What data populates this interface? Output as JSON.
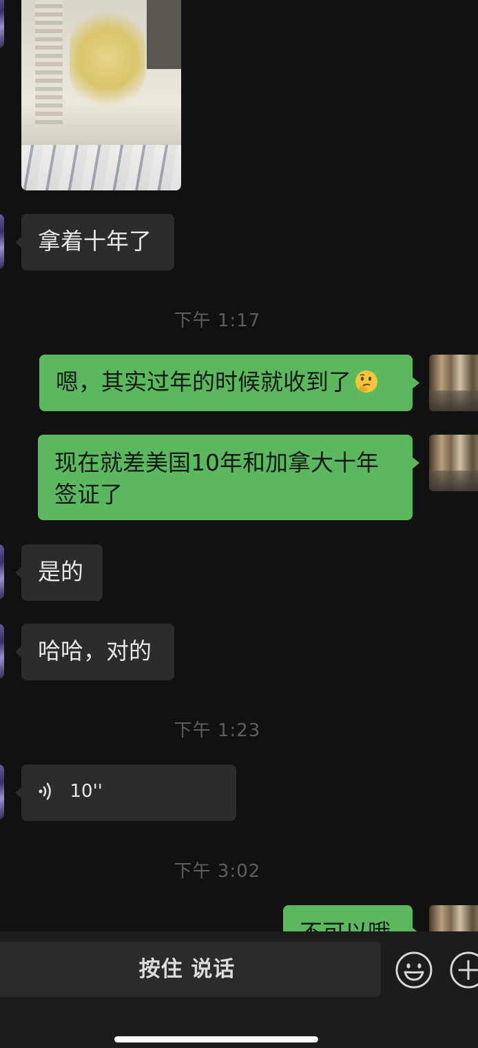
{
  "messages": {
    "m1": {
      "text": "拿着十年了"
    },
    "t1": {
      "text": "下午 1:17"
    },
    "m2": {
      "text": "嗯，其实过年的时候就收到了"
    },
    "m3": {
      "text": "现在就差美国10年和加拿大十年签证了"
    },
    "m4": {
      "text": "是的"
    },
    "m5": {
      "text": "哈哈，对的"
    },
    "t2": {
      "text": "下午 1:23"
    },
    "m6": {
      "duration": "10''"
    },
    "t3": {
      "text": "下午 3:02"
    },
    "m7": {
      "text": "不可以哦"
    }
  },
  "input_bar": {
    "hold_to_talk_label": "按住 说话"
  },
  "icons": {
    "voice": "voice-wave-icon",
    "emoji": "smiley-icon",
    "add": "plus-icon",
    "thinking_emoji": "thinking-face-icon"
  },
  "colors": {
    "background": "#111111",
    "incoming_bubble": "#2c2c2c",
    "outgoing_bubble": "#5cb85f",
    "timestamp": "#5e5e5e"
  }
}
